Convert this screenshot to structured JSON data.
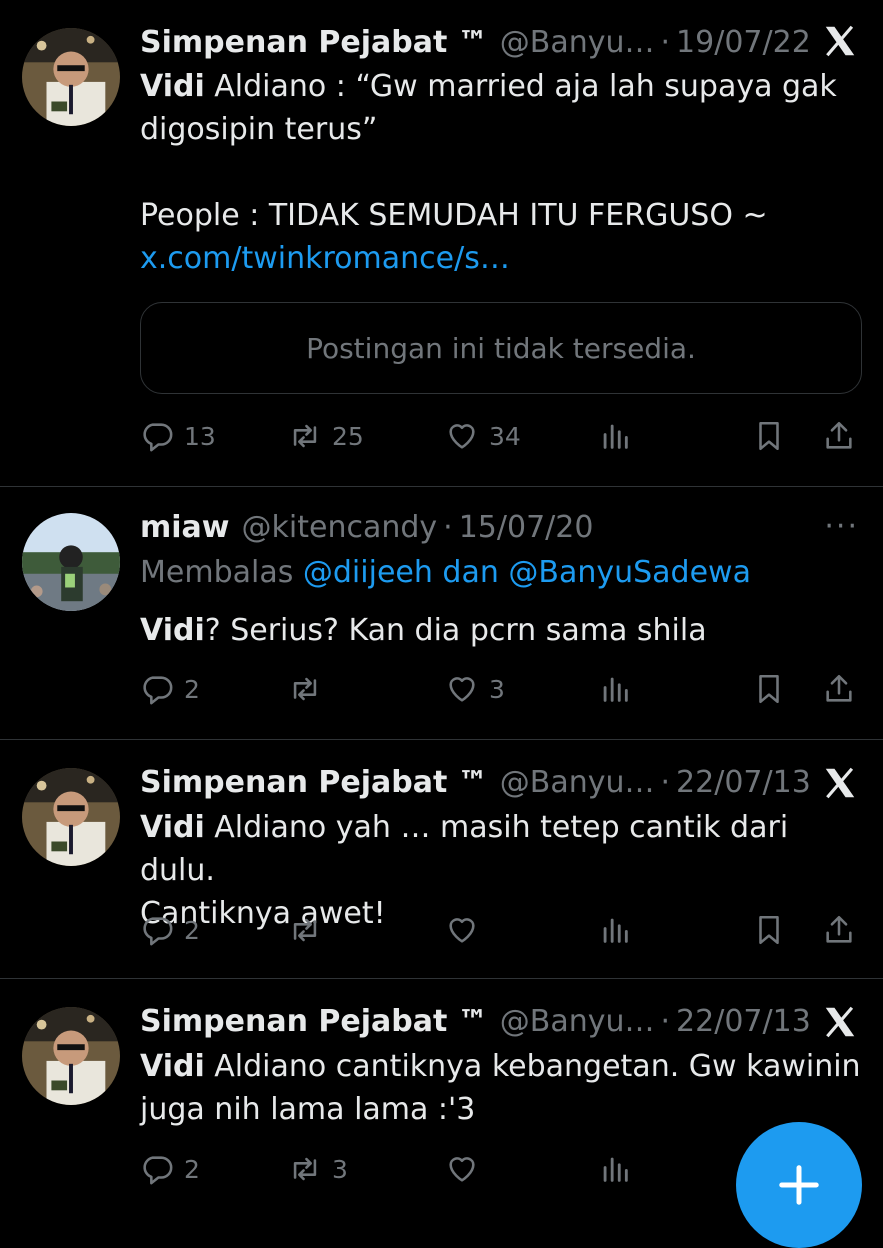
{
  "tweets": [
    {
      "name": "Simpenan Pejabat ™",
      "handle": "@Banyu…",
      "date": "19/07/22",
      "body_bold": "Vidi",
      "body_text": " Aldiano : “Gw married aja lah supaya gak\ndigosipin terus”\n\nPeople : TIDAK SEMUDAH ITU FERGUSO ~",
      "link": "x.com/twinkromance/s…",
      "quote_text": "Postingan ini tidak tersedia.",
      "replies": "13",
      "reposts": "25",
      "likes": "34"
    },
    {
      "name": "miaw",
      "handle": "@kitencandy",
      "date": "15/07/20",
      "reply_prefix": "Membalas ",
      "reply_mentions": "@diijeeh dan @BanyuSadewa",
      "body_bold": "Vidi",
      "body_text": "? Serius? Kan dia pcrn sama shila",
      "replies": "2",
      "reposts": "",
      "likes": "3"
    },
    {
      "name": "Simpenan Pejabat ™",
      "handle": "@Banyu…",
      "date": "22/07/13",
      "body_bold": "Vidi",
      "body_text": " Aldiano yah … masih tetep cantik dari dulu.\nCantiknya awet!",
      "replies": "2",
      "reposts": "",
      "likes": ""
    },
    {
      "name": "Simpenan Pejabat ™",
      "handle": "@Banyu…",
      "date": "22/07/13",
      "body_bold": "Vidi",
      "body_text": " Aldiano cantiknya kebangetan. Gw kawinin\njuga nih lama lama :'3",
      "replies": "2",
      "reposts": "3",
      "likes": ""
    }
  ],
  "separator_dot": "·",
  "more_dots": "···",
  "colors": {
    "accent": "#1d9bf0",
    "muted": "#71767b",
    "text": "#e7e9ea",
    "border": "#2f3336"
  },
  "icons": [
    "x-logo-icon",
    "reply-icon",
    "repost-icon",
    "like-icon",
    "views-icon",
    "bookmark-icon",
    "share-icon",
    "compose-plus-icon",
    "more-icon"
  ]
}
